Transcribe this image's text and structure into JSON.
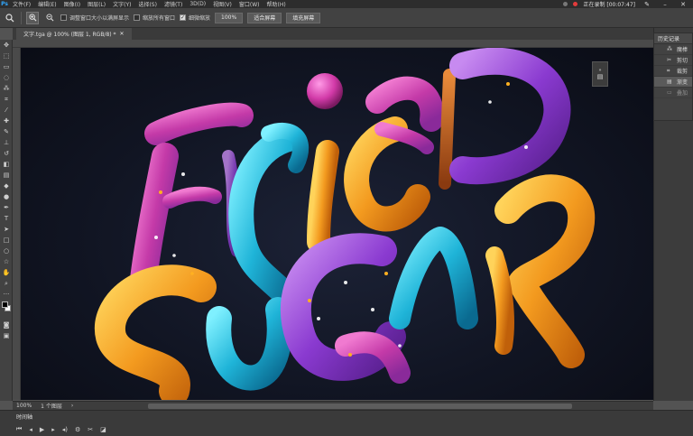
{
  "menubar": {
    "items": [
      "文件(F)",
      "编辑(E)",
      "图像(I)",
      "图层(L)",
      "文字(Y)",
      "选择(S)",
      "滤镜(T)",
      "3D(D)",
      "视图(V)",
      "窗口(W)",
      "帮助(H)"
    ],
    "recording_text": "正在录制 [00:07:47]"
  },
  "options": {
    "resize_windows": "调整窗口大小以满屏显示",
    "zoom_all_windows": "缩放所有窗口",
    "scrubby_zoom": "细微缩放",
    "zoom_100": "100%",
    "fit_screen": "适合屏幕",
    "fill_screen": "填充屏幕"
  },
  "document": {
    "tab_title": "文字.tga @ 100% (图层 1, RGB/8) *"
  },
  "history": {
    "tab_label": "历史记录",
    "items": [
      "魔棒",
      "剪切",
      "裁剪",
      "渐变",
      "叠加"
    ]
  },
  "status": {
    "zoom": "100%",
    "info": "1 个图层"
  },
  "timeline": {
    "title": "时间轴"
  }
}
